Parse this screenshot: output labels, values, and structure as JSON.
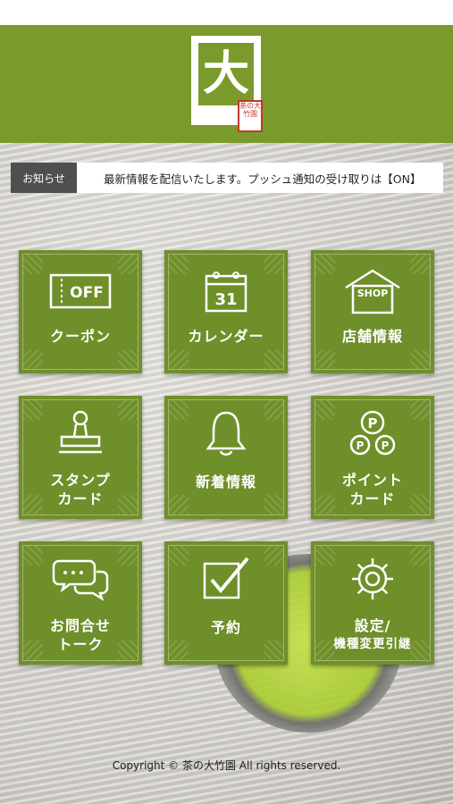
{
  "header": {
    "logo_char": "大",
    "seal_text": "茶の大竹園"
  },
  "news": {
    "label": "お知らせ",
    "text": "最新情報を配信いたします。プッシュ通知の受け取りは【ON】"
  },
  "tiles": [
    {
      "icon": "coupon-ticket-icon",
      "icon_text": "OFF",
      "label": "クーポン"
    },
    {
      "icon": "calendar-icon",
      "icon_text": "31",
      "label": "カレンダー"
    },
    {
      "icon": "shop-house-icon",
      "icon_text": "SHOP",
      "label": "店舗情報"
    },
    {
      "icon": "stamp-icon",
      "label_line1": "スタンプ",
      "label_line2": "カード"
    },
    {
      "icon": "bell-icon",
      "label": "新着情報"
    },
    {
      "icon": "point-coins-icon",
      "icon_text": "P",
      "label_line1": "ポイント",
      "label_line2": "カード"
    },
    {
      "icon": "chat-bubbles-icon",
      "label_line1": "お問合せ",
      "label_line2": "トーク"
    },
    {
      "icon": "checkbox-icon",
      "label": "予約"
    },
    {
      "icon": "gear-icon",
      "label_line1": "設定/",
      "label_line2": "機種変更引継"
    }
  ],
  "footer": {
    "copyright": "Copyright © 茶の大竹園 All rights reserved."
  },
  "colors": {
    "brand_green": "#7b9a2c",
    "tile_green": "#6f8f2a",
    "news_label_bg": "#4f4f4f"
  }
}
